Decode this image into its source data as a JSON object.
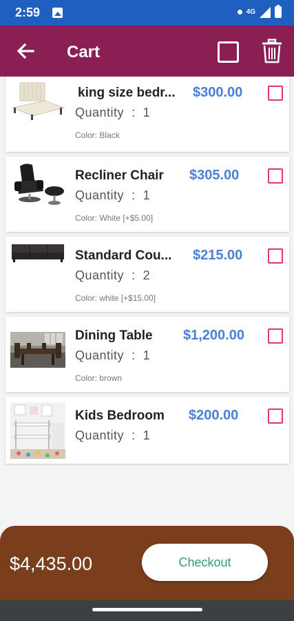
{
  "status_bar": {
    "time": "2:59",
    "network": "4G"
  },
  "app_bar": {
    "title": "Cart"
  },
  "items": [
    {
      "name": "king size bedr...",
      "price": "$300.00",
      "quantity_label": "Quantity",
      "quantity_sep": ":",
      "quantity": "1",
      "color": "Color: Black"
    },
    {
      "name": "Recliner Chair",
      "price": "$305.00",
      "quantity_label": "Quantity",
      "quantity_sep": ":",
      "quantity": "1",
      "color": "Color: White [+$5.00]"
    },
    {
      "name": "Standard Cou...",
      "price": "$215.00",
      "quantity_label": "Quantity",
      "quantity_sep": ":",
      "quantity": "2",
      "color": "Color: white [+$15.00]"
    },
    {
      "name": "Dining Table",
      "price": "$1,200.00",
      "quantity_label": "Quantity",
      "quantity_sep": ":",
      "quantity": "1",
      "color": "Color: brown"
    },
    {
      "name": "Kids Bedroom",
      "price": "$200.00",
      "quantity_label": "Quantity",
      "quantity_sep": ":",
      "quantity": "1",
      "color": ""
    }
  ],
  "footer": {
    "total": "$4,435.00",
    "checkout_label": "Checkout"
  },
  "colors": {
    "status_bar": "#1e5fbf",
    "app_bar": "#8a1f54",
    "price": "#4a7fd6",
    "checkbox": "#e0337a",
    "footer": "#7a3e1d",
    "checkout_text": "#2e9e6a"
  }
}
